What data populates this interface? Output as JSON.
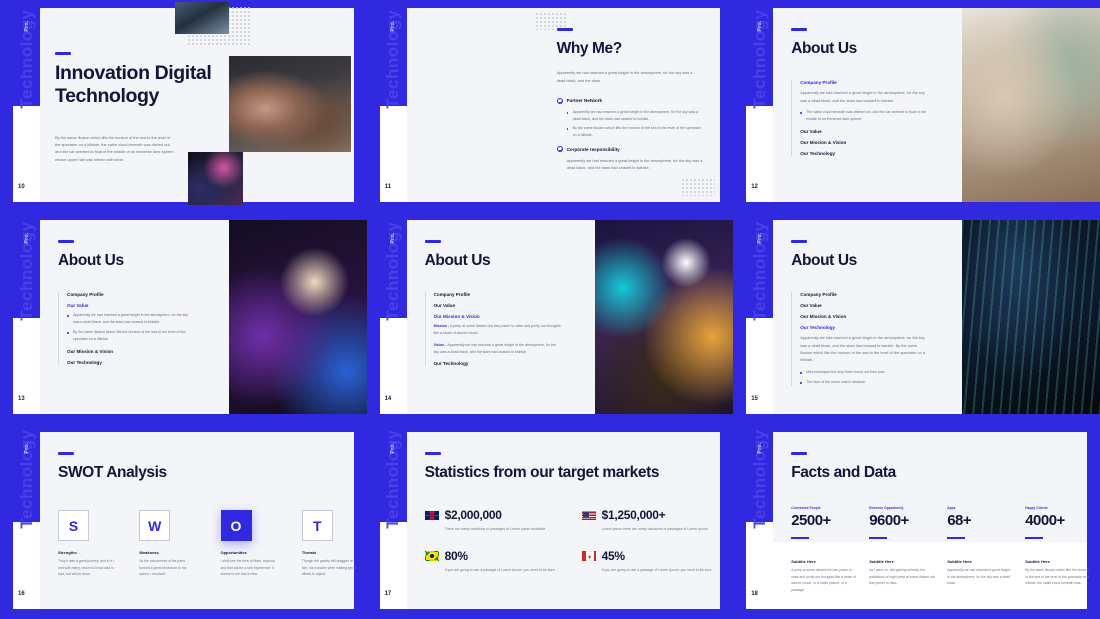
{
  "theme": {
    "brand_purple": "#3029e0",
    "canvas": "#f4f5f8",
    "ink": "#15143a",
    "muted": "#6b6c85"
  },
  "sidebar_tab": {
    "watermark": "Technology",
    "badge": "Pro."
  },
  "slides": [
    {
      "number": "10",
      "title": "Innovation Digital Technology",
      "body": "By the same illusion which lifts the horizon of the sea to the level of the spectator on a hillside, the sable cloud beneath was dished out, and the car seemed to float in the middle of an immense dark sphere, whose upper half was strewn with silver."
    },
    {
      "number": "11",
      "title": "Why Me?",
      "intro": "Apparently we had reached a great height in the atmosphere, for the sky was a dead black, and the stars.",
      "items": [
        {
          "label": "Partner Network",
          "bullets": [
            "Apparently we had reached a great height in the atmosphere, for the sky was a dead black, and the stars had ceased to twinkle.",
            "By the same illusion which lifts the horizon of the sea to the level of the spectator on a hillside."
          ]
        },
        {
          "label": "Corporate responsibility",
          "paragraph": "Apparently we had reached a great height in the atmosphere, for the sky was a dead black, and the stars had ceased to twinkle."
        }
      ]
    },
    {
      "number": "12",
      "title": "About Us",
      "nav": [
        "Company Profile",
        "Our Value",
        "Our Mission & Vision",
        "Our Technology"
      ],
      "active": "Company Profile",
      "paragraph": "Apparently we had reached a great height in the atmosphere, for the sky was a dead black, and the stars had ceased to twinkle.",
      "bullets": [
        "The sable cloud beneath was dished out, and the car seemed to float in the middle of an immense dark sphere."
      ]
    },
    {
      "number": "13",
      "title": "About Us",
      "nav": [
        "Company Profile",
        "Our Value",
        "Our Mission & Vision",
        "Our Technology"
      ],
      "active": "Our Value",
      "bullets": [
        "Apparently we had reached a great height in the atmosphere, for the sky was a dead black, and the stars had ceased to twinkle.",
        "By the same illusion which lifts the horizon of the sea to the level of the spectator on a hillside."
      ]
    },
    {
      "number": "14",
      "title": "About Us",
      "nav": [
        "Company Profile",
        "Our Value",
        "Our Mission & Vision",
        "Our Technology"
      ],
      "active": "Our Mission & Vision",
      "mission_label": "Mission -",
      "mission_text": " A peep at some distant orb has power to raise and purify our thoughts like a strain of sacred music.",
      "vision_label": "Vision -",
      "vision_text": " Apparently we had reached a great height in the atmosphere, for the sky was a dead black, and the stars had ceased to twinkle."
    },
    {
      "number": "15",
      "title": "About Us",
      "nav": [
        "Company Profile",
        "Our Value",
        "Our Mission & Vision",
        "Our Technology"
      ],
      "active": "Our Technology",
      "paragraph": "Apparently we had reached a great height in the atmosphere, for the sky was a dead black, and the stars had ceased to twinkle. By the same illusion which lifts the horizon of the sea to the level of the spectator on a hillside.",
      "bullets": [
        "Mist enveloped the ship three hours out from port.",
        "The face of the moon was in shadow."
      ]
    },
    {
      "number": "16",
      "title": "SWOT Analysis",
      "swot": [
        {
          "letter": "S",
          "name": "Strengths",
          "active": false,
          "desc": "Truly it was a great journey, and in it I met with many, whom to know was to love, but whom never."
        },
        {
          "letter": "W",
          "name": "Weakness",
          "active": false,
          "desc": "As the minuteness of the parts formed a great hindrance to my speed, I resolved."
        },
        {
          "letter": "O",
          "name": "Opportunities",
          "active": true,
          "desc": "I shall see the face of Mars, anyhow, and that will be a rare experience. It seems to me that a view."
        },
        {
          "letter": "T",
          "name": "Threats",
          "active": false,
          "desc": "Though the gravity still dragged at him, his muscles were making great efforts to adjust."
        }
      ]
    },
    {
      "number": "17",
      "title": "Statistics from our target markets",
      "stats": [
        {
          "flag": "flag-uk-icon",
          "value": "$2,000,000",
          "desc": "There are many variations of passages of Lorem Ipsum available."
        },
        {
          "flag": "flag-us-icon",
          "value": "$1,250,000+",
          "desc": "Lorem Ipsum there are many variations of passages of Lorem Ipsum."
        },
        {
          "flag": "flag-br-icon",
          "value": "80%",
          "desc": "If you are going to use a passage of Lorem Ipsum, you need to be sure."
        },
        {
          "flag": "flag-ca-icon",
          "value": "45%",
          "desc": "If you are going to use a passage of Lorem Ipsum, you need to be sure."
        }
      ]
    },
    {
      "number": "18",
      "title": "Facts and Data",
      "facts": [
        {
          "label": "Connected People",
          "value": "2500+",
          "sub": "Subtitle Here",
          "text": "A peep at some distant orb has power to raise and purify our thoughts like a strain of sacred music, or a noble picture, or a passage."
        },
        {
          "label": "Revenue Opportunity",
          "value": "9600+",
          "sub": "Subtitle Here",
          "text": "As I went on, still gaining velocity, the palpitation of night peep at some distant orb has power to raise."
        },
        {
          "label": "Apps",
          "value": "68+",
          "sub": "Subtitle Here",
          "text": "Apparently we had reached a great height in the atmosphere, for the sky was a dead black."
        },
        {
          "label": "Happy Clients",
          "value": "4000+",
          "sub": "Subtitle Here",
          "text": "By the same illusion which lifts the horizon of the sea to the level of the spectator on a hillside, the sable cloud beneath was."
        }
      ]
    }
  ]
}
